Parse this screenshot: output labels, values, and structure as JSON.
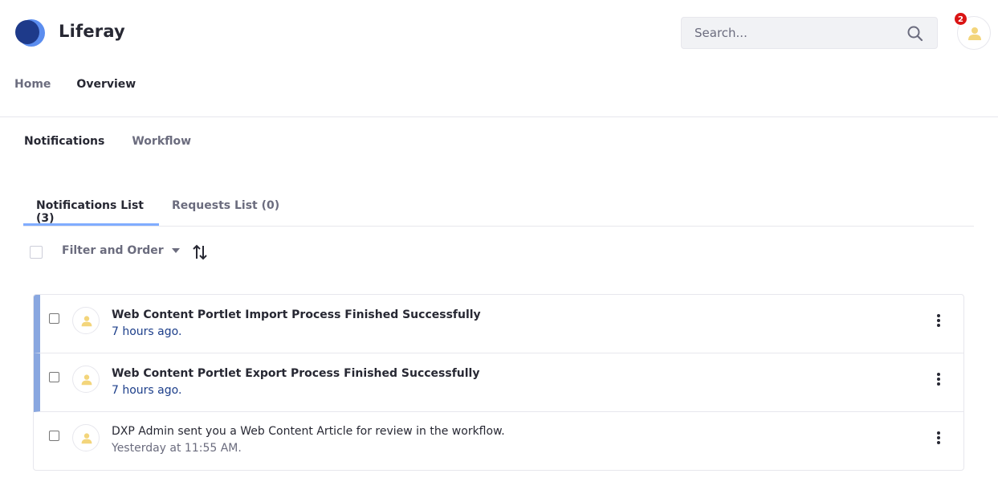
{
  "header": {
    "site_name": "Liferay",
    "search_placeholder": "Search...",
    "notification_count": "2"
  },
  "top_nav": {
    "items": [
      {
        "label": "Home",
        "active": false
      },
      {
        "label": "Overview",
        "active": true
      }
    ]
  },
  "sub_nav": {
    "items": [
      {
        "label": "Notifications",
        "active": true
      },
      {
        "label": "Workflow",
        "active": false
      }
    ]
  },
  "tabs": [
    {
      "label": "Notifications List (3)",
      "active": true
    },
    {
      "label": "Requests List (0)",
      "active": false
    }
  ],
  "toolbar": {
    "filter_label": "Filter and Order",
    "filter_icon": "caret-down-icon",
    "order_icon": "order-arrows-icon"
  },
  "notifications": [
    {
      "title": "Web Content Portlet Import Process Finished Successfully",
      "time": "7 hours ago.",
      "unread": true
    },
    {
      "title": "Web Content Portlet Export Process Finished Successfully",
      "time": "7 hours ago.",
      "unread": true
    },
    {
      "title": "DXP Admin sent you a Web Content Article for review in the workflow.",
      "time": "Yesterday at 11:55 AM.",
      "unread": false
    }
  ],
  "colors": {
    "accent": "#80acff",
    "unread_bar": "#89a7e0",
    "badge": "#da1414",
    "unread_time": "#1c3e8a",
    "avatar_icon": "#f3d57b"
  }
}
